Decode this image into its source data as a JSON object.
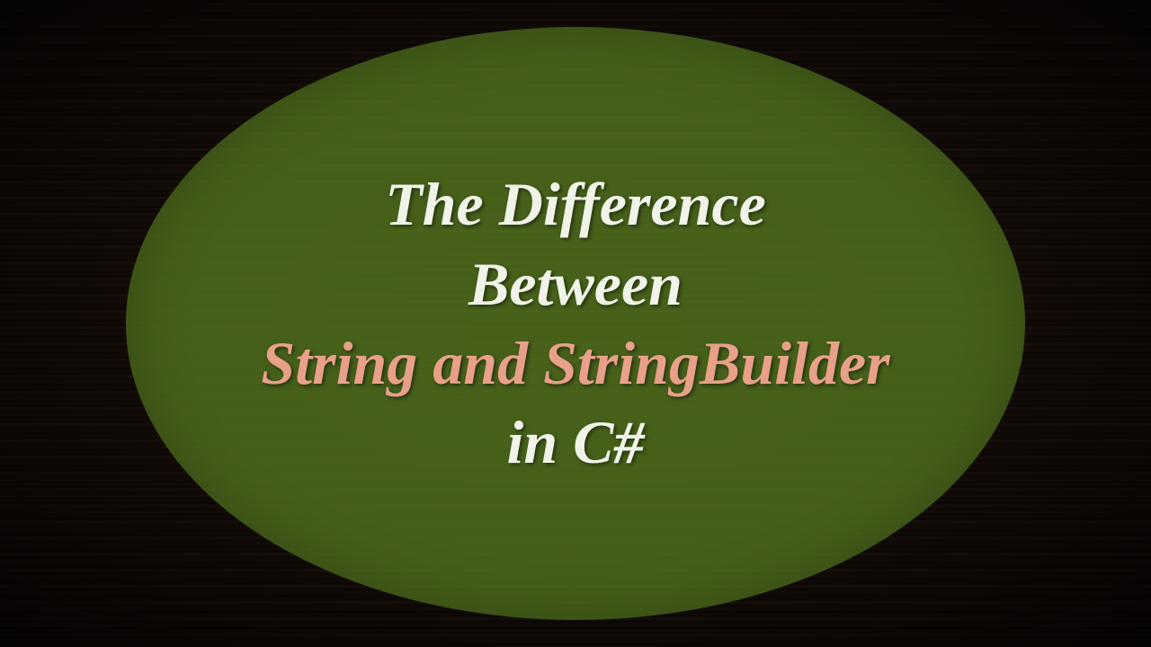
{
  "title": {
    "line1": "The Difference",
    "line2": "Between",
    "line3": "String and StringBuilder",
    "line4": "in C#"
  },
  "colors": {
    "accent": "#e8a188",
    "light": "#f0f4e8",
    "ellipse": "rgba(80,115,30,0.82)"
  }
}
